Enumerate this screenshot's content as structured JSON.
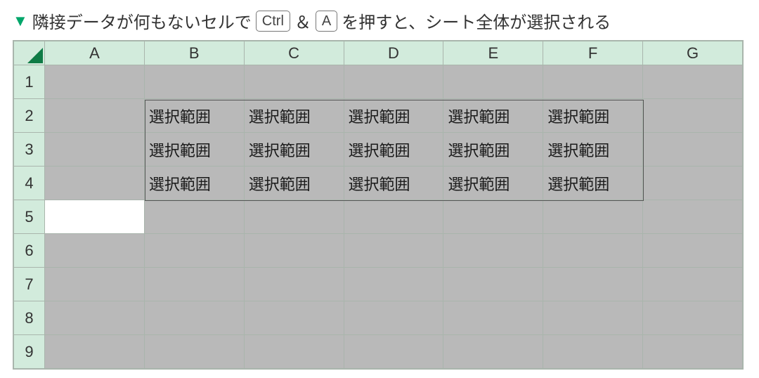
{
  "caption": {
    "triangle": "▼",
    "part1": "隣接データが何もないセルで",
    "key1": "Ctrl",
    "amp": "＆",
    "key2": "A",
    "part2": "を押すと、シート全体が選択される"
  },
  "sheet": {
    "columns": [
      "A",
      "B",
      "C",
      "D",
      "E",
      "F",
      "G"
    ],
    "rows": [
      "1",
      "2",
      "3",
      "4",
      "5",
      "6",
      "7",
      "8",
      "9"
    ],
    "activeCell": {
      "row": 4,
      "col": 0
    },
    "dataRange": {
      "startRow": 1,
      "endRow": 3,
      "startCol": 1,
      "endCol": 5
    },
    "cells": {
      "r1c1": "選択範囲",
      "r1c2": "選択範囲",
      "r1c3": "選択範囲",
      "r1c4": "選択範囲",
      "r1c5": "選択範囲",
      "r2c1": "選択範囲",
      "r2c2": "選択範囲",
      "r2c3": "選択範囲",
      "r2c4": "選択範囲",
      "r2c5": "選択範囲",
      "r3c1": "選択範囲",
      "r3c2": "選択範囲",
      "r3c3": "選択範囲",
      "r3c4": "選択範囲",
      "r3c5": "選択範囲"
    }
  }
}
